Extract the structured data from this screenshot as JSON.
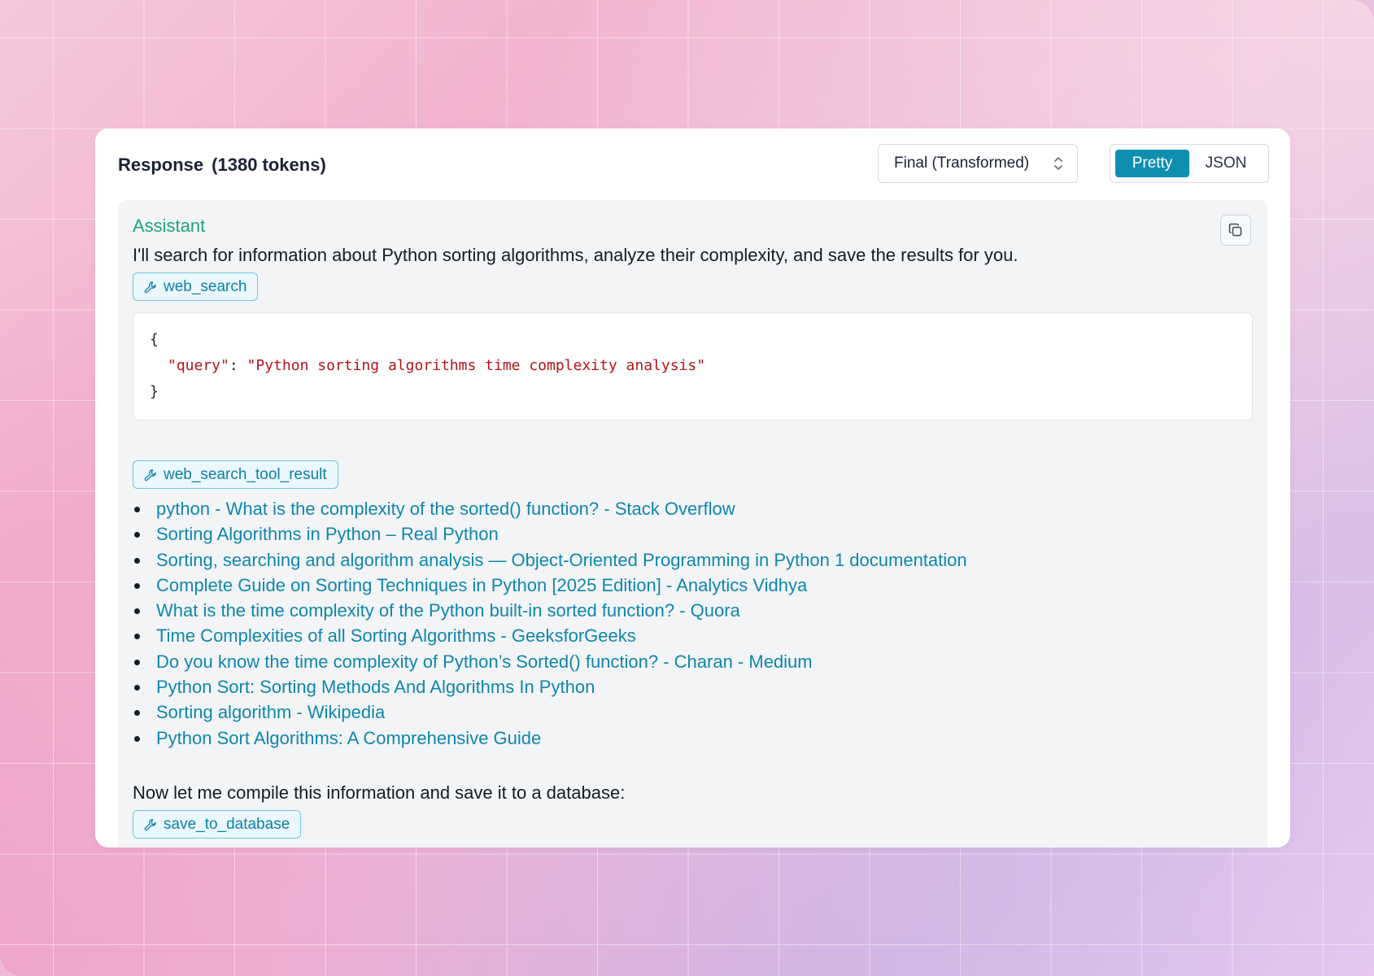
{
  "header": {
    "title": "Response",
    "tokens": "(1380 tokens)",
    "view_select": {
      "value": "Final (Transformed)"
    },
    "format_toggle": {
      "options": [
        "Pretty",
        "JSON"
      ],
      "selected": "Pretty"
    }
  },
  "message": {
    "role": "Assistant",
    "intro": "I'll search for information about Python sorting algorithms, analyze their complexity, and save the results for you.",
    "tool_call": {
      "name": "web_search",
      "code": {
        "open": "{",
        "key": "\"query\"",
        "sep": ": ",
        "value": "\"Python sorting algorithms time complexity analysis\"",
        "close": "}"
      }
    },
    "tool_result": {
      "name": "web_search_tool_result",
      "links": [
        "python - What is the complexity of the sorted() function? - Stack Overflow",
        "Sorting Algorithms in Python – Real Python",
        "Sorting, searching and algorithm analysis — Object-Oriented Programming in Python 1 documentation",
        "Complete Guide on Sorting Techniques in Python [2025 Edition] - Analytics Vidhya",
        "What is the time complexity of the Python built-in sorted function? - Quora",
        "Time Complexities of all Sorting Algorithms - GeeksforGeeks",
        "Do you know the time complexity of Python’s Sorted() function? - Charan - Medium",
        "Python Sort: Sorting Methods And Algorithms In Python",
        "Sorting algorithm - Wikipedia",
        "Python Sort Algorithms: A Comprehensive Guide"
      ]
    },
    "followup": "Now let me compile this information and save it to a database:",
    "second_tool_call": {
      "name": "save_to_database"
    }
  },
  "icons": {
    "tool": "wrench-icon",
    "copy": "copy-icon",
    "select": "chevron-up-down-icon"
  },
  "colors": {
    "accent": "#0e8fb2",
    "link": "#0e87ad",
    "role": "#19a67f",
    "json_string": "#b3141b"
  }
}
